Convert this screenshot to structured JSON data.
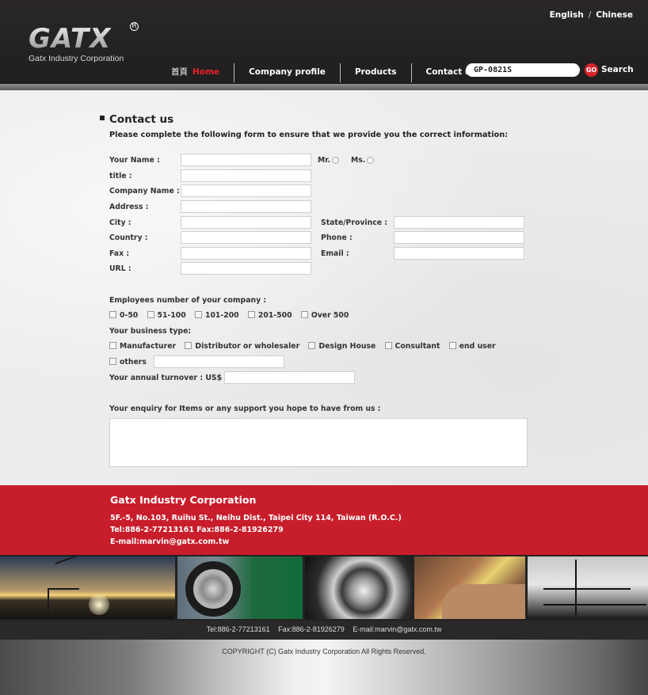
{
  "header": {
    "logo_text": "GATX",
    "tagline": "Gatx Industry Corporation",
    "lang": {
      "english": "English",
      "separator": "/",
      "chinese": "Chinese"
    },
    "nav": [
      {
        "zh": "首頁",
        "label": "Home"
      },
      {
        "label": "Company profile"
      },
      {
        "label": "Products"
      },
      {
        "label": "Contact us"
      }
    ],
    "search": {
      "value": "GP-0821S",
      "go_label": "GO",
      "search_label": "Search"
    }
  },
  "form": {
    "title": "Contact us",
    "subtitle": "Please complete the following form to ensure that we provide you the correct information:",
    "fields": {
      "your_name": "Your Name :",
      "mr": "Mr.",
      "ms": "Ms.",
      "title": "title :",
      "company_name": "Company Name :",
      "address": "Address :",
      "city": "City :",
      "state": "State/Province :",
      "country": "Country :",
      "phone": "Phone :",
      "fax": "Fax :",
      "email": "Email :",
      "url": "URL :"
    },
    "employees_label": "Employees number of your company :",
    "employees_options": [
      "0-50",
      "51-100",
      "101-200",
      "201-500",
      "Over 500"
    ],
    "business_label": "Your business type:",
    "business_options": [
      "Manufacturer",
      "Distributor or wholesaler",
      "Design House",
      "Consultant",
      "end user"
    ],
    "others_label": "others",
    "turnover_label": "Your annual turnover : US$",
    "enquiry_label": "Your enquiry for Items or any support you hope to have from us :"
  },
  "footer": {
    "company": "Gatx Industry Corporation",
    "address": "5F.-5, No.103, Ruihu St., Neihu Dist., Taipei City 114, Taiwan (R.O.C.)",
    "tel_fax": "Tel:886-2-77213161    Fax:886-2-81926279",
    "email": "E-mail:marvin@gatx.com.tw",
    "contact_tel": "Tel:886-2-77213161",
    "contact_fax": "Fax:886-2-81926279",
    "contact_email": "E-mail:marvin@gatx.com.tw",
    "copyright": "COPYRIGHT (C) Gatx Industry Corporation  All Rights Reserved."
  }
}
